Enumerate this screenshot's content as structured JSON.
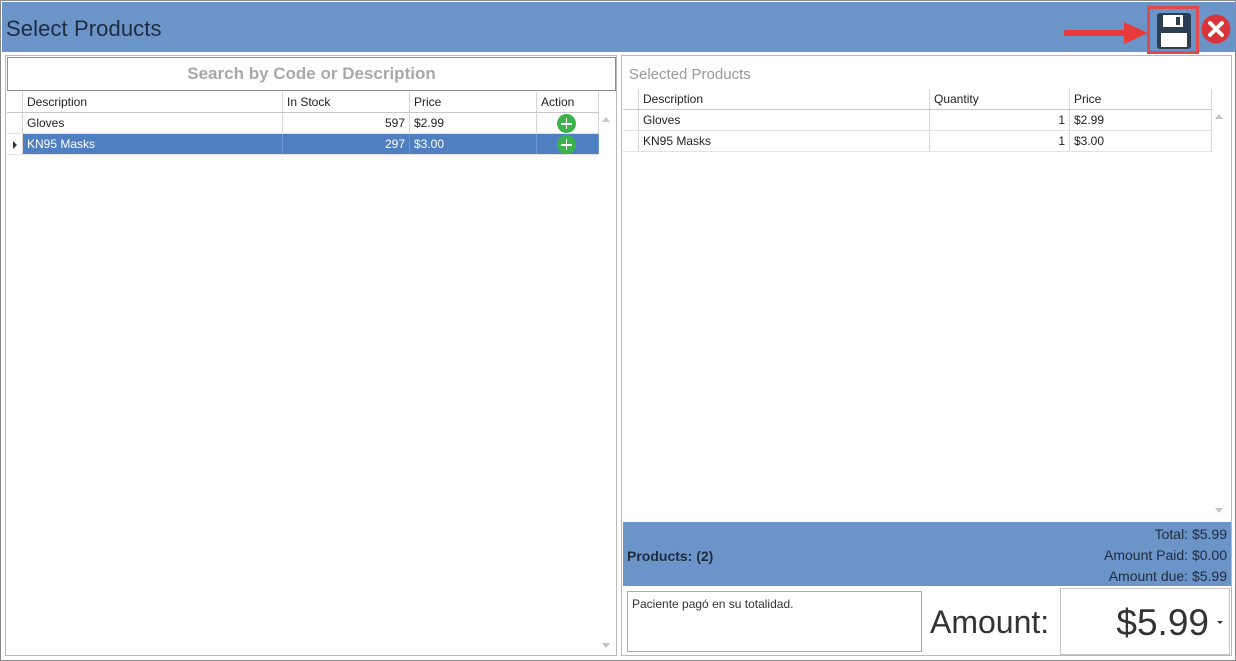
{
  "window": {
    "title": "Select Products"
  },
  "toolbar": {
    "save_icon": "floppy-disk-icon",
    "close_icon": "close-circle-icon",
    "highlight_color": "#e04a4a",
    "titlebar_color": "#6b95c9"
  },
  "search": {
    "placeholder": "Search by Code or Description",
    "value": ""
  },
  "products_grid": {
    "columns": [
      "Description",
      "In Stock",
      "Price",
      "Action"
    ],
    "rows": [
      {
        "description": "Gloves",
        "in_stock": "597",
        "price": "$2.99",
        "action_icon": "add-icon",
        "selected": false
      },
      {
        "description": "KN95 Masks",
        "in_stock": "297",
        "price": "$3.00",
        "action_icon": "add-icon",
        "selected": true
      }
    ]
  },
  "selected_products": {
    "title": "Selected Products",
    "columns": [
      "Description",
      "Quantity",
      "Price"
    ],
    "rows": [
      {
        "description": "Gloves",
        "quantity": "1",
        "price": "$2.99"
      },
      {
        "description": "KN95 Masks",
        "quantity": "1",
        "price": "$3.00"
      }
    ]
  },
  "summary": {
    "products_count": "Products: (2)",
    "total": "Total: $5.99",
    "amount_paid": "Amount Paid: $0.00",
    "amount_due": "Amount due: $5.99"
  },
  "payment": {
    "notes": "Paciente pagó en su totalidad.",
    "amount_label": "Amount:",
    "amount_value": "$5.99"
  }
}
